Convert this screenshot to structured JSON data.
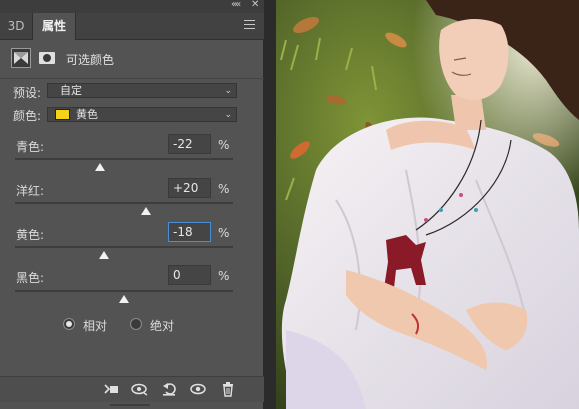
{
  "panel": {
    "collapse_glyph": "««",
    "close_glyph": "✕",
    "tabs": [
      {
        "label": "3D"
      },
      {
        "label": "属性"
      }
    ],
    "menu_icon": "panel-menu-icon",
    "header": {
      "adjustment_icon": "selective-color-icon",
      "mask_icon": "layer-mask-icon",
      "title": "可选颜色"
    },
    "preset": {
      "label": "预设:",
      "value": "自定"
    },
    "colors": {
      "label": "颜色:",
      "value": "黄色",
      "swatch": "#f3d21a"
    },
    "sliders": [
      {
        "label": "青色:",
        "value": "-22",
        "unit": "%",
        "level": -22
      },
      {
        "label": "洋红:",
        "value": "+20",
        "unit": "%",
        "level": 20
      },
      {
        "label": "黄色:",
        "value": "-18",
        "unit": "%",
        "level": -18
      },
      {
        "label": "黑色:",
        "value": "0",
        "unit": "%",
        "level": 0
      }
    ],
    "method": {
      "options": [
        {
          "label": "相对",
          "selected": true
        },
        {
          "label": "绝对",
          "selected": false
        }
      ]
    },
    "bottom_icons": [
      "clip-to-layer-icon",
      "view-previous-state-icon",
      "reset-icon",
      "visibility-eye-icon",
      "delete-trash-icon"
    ]
  },
  "colors": {
    "panel_bg": "#535353",
    "focus_ring": "#4a8fd6"
  }
}
